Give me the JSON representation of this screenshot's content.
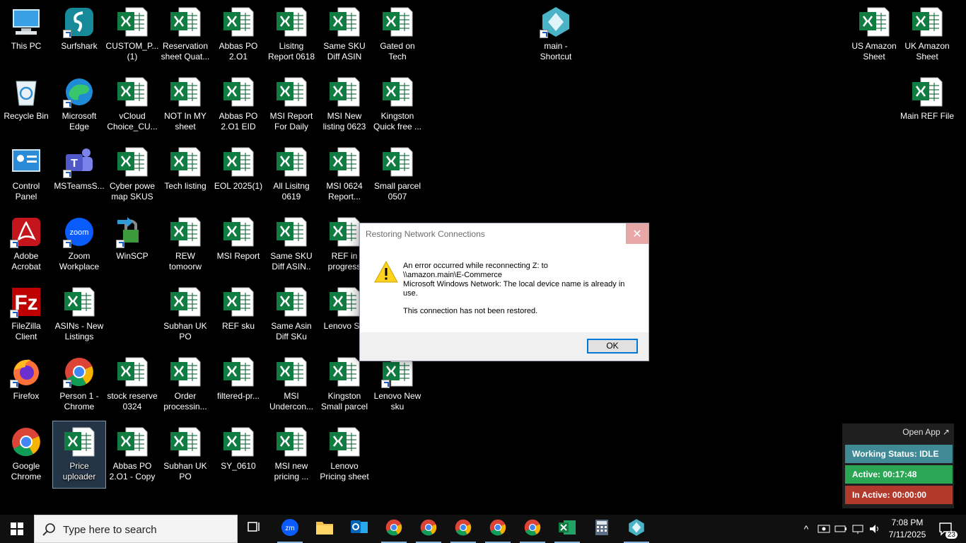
{
  "desktop": {
    "icons": [
      {
        "label": "This PC",
        "icon": "this-pc-icon"
      },
      {
        "label": "Surfshark",
        "icon": "surfshark-icon"
      },
      {
        "label": "CUSTOM_P...\n(1)",
        "icon": "excel-file-icon"
      },
      {
        "label": "Reservation\nsheet Quat...",
        "icon": "excel-file-icon"
      },
      {
        "label": "Abbas PO\n2.O1",
        "icon": "excel-file-icon"
      },
      {
        "label": "Lisitng\nReport 0618",
        "icon": "excel-file-icon"
      },
      {
        "label": "Same SKU\nDiff ASIN",
        "icon": "excel-file-icon"
      },
      {
        "label": "Gated on\nTech",
        "icon": "excel-file-icon"
      },
      {
        "label": "Recycle Bin",
        "icon": "recycle-bin-icon"
      },
      {
        "label": "Microsoft\nEdge",
        "icon": "edge-icon"
      },
      {
        "label": "vCloud\nChoice_CU...",
        "icon": "excel-file-icon"
      },
      {
        "label": "NOT In MY\nsheet",
        "icon": "excel-file-icon"
      },
      {
        "label": "Abbas PO\n2.O1  EID",
        "icon": "excel-file-icon"
      },
      {
        "label": "MSI Report\nFor Daily",
        "icon": "excel-file-icon"
      },
      {
        "label": "MSI New\nlisting 0623",
        "icon": "excel-file-icon"
      },
      {
        "label": "Kingston\nQuick free ...",
        "icon": "excel-file-icon"
      },
      {
        "label": "Control\nPanel",
        "icon": "control-panel-icon"
      },
      {
        "label": "MSTeamsS...",
        "icon": "teams-icon"
      },
      {
        "label": "Cyber powe\nmap SKUS",
        "icon": "excel-file-icon"
      },
      {
        "label": "Tech listing",
        "icon": "excel-file-icon"
      },
      {
        "label": "EOL 2025(1)",
        "icon": "excel-file-icon"
      },
      {
        "label": "All Lisitng\n0619",
        "icon": "excel-file-icon"
      },
      {
        "label": "MSI 0624\nReport...",
        "icon": "excel-file-icon"
      },
      {
        "label": "Small parcel\n0507",
        "icon": "excel-file-icon"
      },
      {
        "label": "Adobe\nAcrobat",
        "icon": "acrobat-icon"
      },
      {
        "label": "Zoom\nWorkplace",
        "icon": "zoom-icon"
      },
      {
        "label": "WinSCP",
        "icon": "winscp-icon"
      },
      {
        "label": "REW\ntomoorw",
        "icon": "excel-file-icon"
      },
      {
        "label": "MSI Report",
        "icon": "excel-file-icon"
      },
      {
        "label": "Same SKU\nDiff ASIN..",
        "icon": "excel-file-icon"
      },
      {
        "label": "REF in\nprogress",
        "icon": "excel-file-icon"
      },
      {
        "label": "FileZilla\nClient",
        "icon": "filezilla-icon"
      },
      {
        "label": "ASINs - New\nListings",
        "icon": "excel-file-icon"
      },
      {
        "label": "Subhan UK\nPO",
        "icon": "excel-file-icon"
      },
      {
        "label": "REF sku",
        "icon": "excel-file-icon"
      },
      {
        "label": "Same Asin\nDiff SKu",
        "icon": "excel-file-icon"
      },
      {
        "label": "Lenovo SK",
        "icon": "excel-file-icon"
      },
      {
        "label": "Firefox",
        "icon": "firefox-icon"
      },
      {
        "label": "Person 1 -\nChrome",
        "icon": "chrome-icon"
      },
      {
        "label": "stock reserve\n0324",
        "icon": "excel-file-icon"
      },
      {
        "label": "Order\nprocessin...",
        "icon": "excel-file-icon"
      },
      {
        "label": "filtered-pr...",
        "icon": "excel-file-icon"
      },
      {
        "label": "MSI\nUndercon...",
        "icon": "excel-file-icon"
      },
      {
        "label": "Kingston\nSmall parcel",
        "icon": "excel-file-icon"
      },
      {
        "label": "Lenovo New\nsku",
        "icon": "excel-file-icon"
      },
      {
        "label": "Google\nChrome",
        "icon": "chrome-icon"
      },
      {
        "label": "Price\nuploader",
        "icon": "excel-file-icon"
      },
      {
        "label": "Abbas PO\n2.O1 - Copy",
        "icon": "excel-file-icon"
      },
      {
        "label": "Subhan UK\nPO",
        "icon": "excel-file-icon"
      },
      {
        "label": "SY_0610",
        "icon": "excel-file-icon"
      },
      {
        "label": "MSI new\npricing ...",
        "icon": "excel-file-icon"
      },
      {
        "label": "Lenovo\nPricing sheet",
        "icon": "excel-file-icon"
      },
      {
        "label": "main -\nShortcut",
        "icon": "app-shortcut-icon"
      },
      {
        "label": "US Amazon\nSheet",
        "icon": "excel-file-icon"
      },
      {
        "label": "UK Amazon\nSheet",
        "icon": "excel-file-icon"
      },
      {
        "label": "Main REF File",
        "icon": "excel-file-icon"
      }
    ]
  },
  "dialog": {
    "title": "Restoring Network Connections",
    "line1": "An error occurred while reconnecting Z: to",
    "line2": "\\\\amazon.main\\E-Commerce",
    "line3": "Microsoft Windows Network: The local device name is already in use.",
    "line4": "This connection has not been restored.",
    "ok_label": "OK",
    "close_glyph": "✕"
  },
  "widget": {
    "open_app": "Open App ↗",
    "working_status": "Working Status: IDLE",
    "active": "Active: 00:17:48",
    "inactive": "In Active: 00:00:00",
    "colors": {
      "idle": "#3f8a94",
      "active": "#2aa654",
      "inactive": "#b23a2c"
    }
  },
  "taskbar": {
    "search_placeholder": "Type here to search",
    "time": "7:08 PM",
    "date": "7/11/2025",
    "notification_count": "23",
    "apps": [
      "task-view-icon",
      "zoom-icon",
      "file-explorer-icon",
      "outlook-icon",
      "chrome-icon",
      "chrome-icon",
      "chrome-icon",
      "chrome-icon",
      "chrome-icon",
      "excel-icon",
      "calculator-icon",
      "app-shortcut-icon"
    ]
  }
}
